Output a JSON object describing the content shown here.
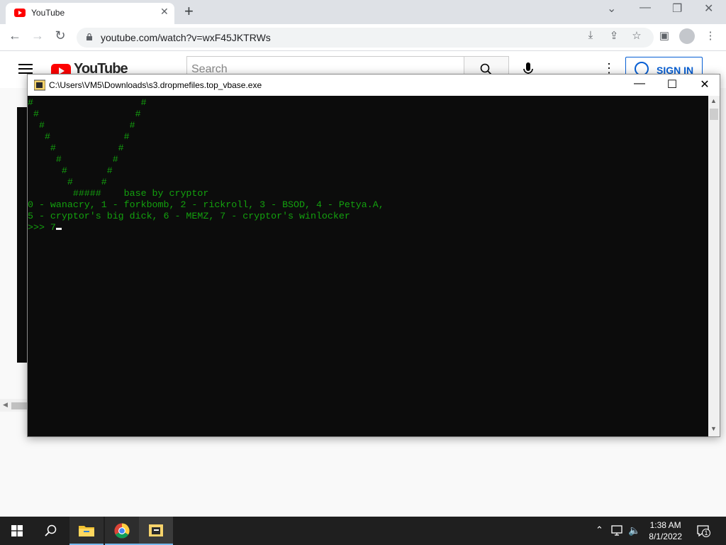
{
  "browser": {
    "tab_title": "YouTube",
    "tab_close": "✕",
    "new_tab": "+",
    "url": "youtube.com/watch?v=wxF45JKTRWs",
    "window_controls": {
      "minimize": "—",
      "restore": "❐",
      "close": "✕",
      "dropdown": "⌄"
    }
  },
  "youtube": {
    "logo_text": "YouTube",
    "search_placeholder": "Search",
    "sign_in_label": "SIGN IN",
    "more": "⋮"
  },
  "console": {
    "title": "C:\\Users\\VM5\\Downloads\\s3.dropmefiles.top_vbase.exe",
    "lines": [
      "#                   #",
      " #                 #",
      "  #               #",
      "   #             #",
      "    #           #",
      "     #         #",
      "      #       #",
      "       #     #",
      "        #####    base by cryptor",
      "0 - wanacry, 1 - forkbomb, 2 - rickroll, 3 - BSOD, 4 - Petya.A,",
      "5 - cryptor's big dick, 6 - MEMZ, 7 - cryptor's winlocker"
    ],
    "prompt": ">>> 7",
    "text_color": "#13a10e"
  },
  "taskbar": {
    "time": "1:38 AM",
    "date": "8/1/2022",
    "notification_count": "1"
  },
  "colors": {
    "youtube_red": "#ff0000",
    "signin_blue": "#065fd4",
    "taskbar_bg": "#1f1f1f",
    "console_bg": "#0c0c0c"
  },
  "icons": [
    "windows-start-icon",
    "search-icon",
    "file-explorer-icon",
    "chrome-icon",
    "console-app-icon",
    "chevron-up-icon",
    "network-icon",
    "volume-icon",
    "notification-icon"
  ]
}
